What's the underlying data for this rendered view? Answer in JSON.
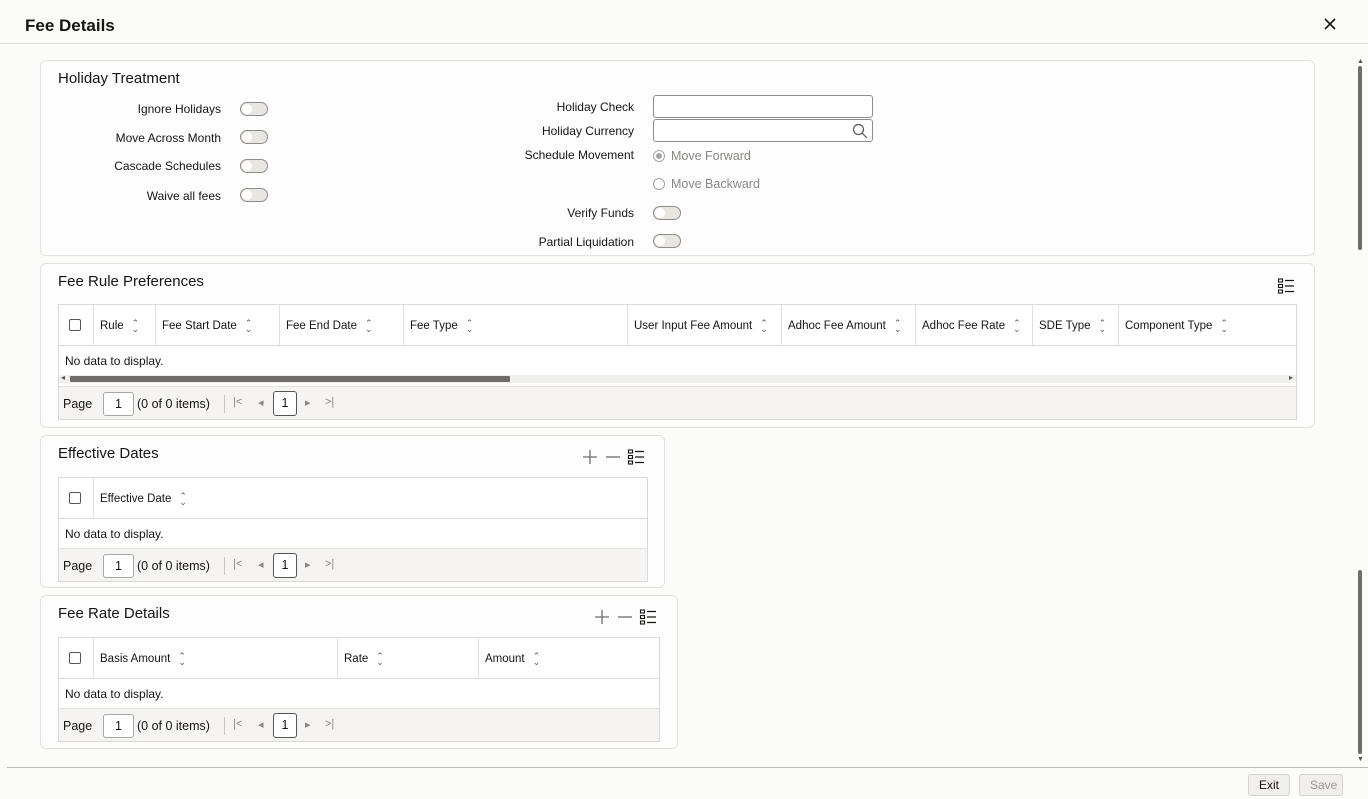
{
  "window": {
    "title": "Fee Details"
  },
  "holiday_treatment": {
    "title": "Holiday Treatment",
    "ignore_holidays": "Ignore Holidays",
    "move_across_month": "Move Across Month",
    "cascade_schedules": "Cascade Schedules",
    "waive_all_fees": "Waive all fees",
    "holiday_check": "Holiday Check",
    "holiday_check_value": "",
    "holiday_currency": "Holiday Currency",
    "holiday_currency_value": "",
    "schedule_movement": "Schedule Movement",
    "move_forward": "Move Forward",
    "move_backward": "Move Backward",
    "schedule_movement_selected": "Move Forward",
    "verify_funds": "Verify Funds",
    "partial_liquidation": "Partial Liquidation"
  },
  "fee_rule_preferences": {
    "title": "Fee Rule Preferences",
    "columns": [
      "Rule",
      "Fee Start Date",
      "Fee End Date",
      "Fee Type",
      "User Input Fee Amount",
      "Adhoc Fee Amount",
      "Adhoc Fee Rate",
      "SDE Type",
      "Component Type"
    ],
    "empty_text": "No data to display.",
    "pager": {
      "label": "Page",
      "page": "1",
      "info": "(0 of 0 items)",
      "current": "1"
    }
  },
  "effective_dates": {
    "title": "Effective Dates",
    "columns": [
      "Effective Date"
    ],
    "empty_text": "No data to display.",
    "pager": {
      "label": "Page",
      "page": "1",
      "info": "(0 of 0 items)",
      "current": "1"
    }
  },
  "fee_rate_details": {
    "title": "Fee Rate Details",
    "columns": [
      "Basis Amount",
      "Rate",
      "Amount"
    ],
    "empty_text": "No data to display.",
    "pager": {
      "label": "Page",
      "page": "1",
      "info": "(0 of 0 items)",
      "current": "1"
    }
  },
  "footer": {
    "exit": "Exit",
    "save": "Save"
  },
  "icons": {
    "close": "close-icon",
    "search": "search-icon",
    "add": "plus-icon",
    "remove": "minus-icon",
    "column_manager": "list-columns-icon"
  },
  "colors": {
    "text": "#161513",
    "disabled_text": "#8a8784",
    "border": "#e4e1dd"
  }
}
